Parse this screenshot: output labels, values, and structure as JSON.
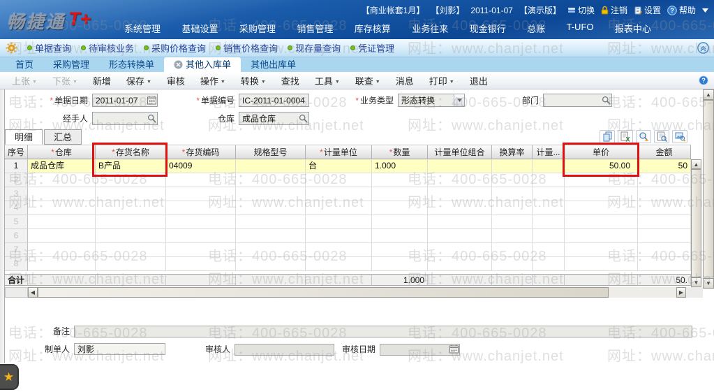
{
  "header": {
    "logo_text": "畅捷通",
    "logo_plus": "T+",
    "account_info": [
      "【商业帐套1月】",
      "【刘影】",
      "2011-01-07",
      "【演示版】"
    ],
    "actions": [
      {
        "icon": "switch-icon",
        "label": "切换"
      },
      {
        "icon": "logout-lock-icon",
        "label": "注销"
      },
      {
        "icon": "settings-icon",
        "label": "设置"
      },
      {
        "icon": "help-icon",
        "label": "帮助"
      },
      {
        "icon": "caret-down-icon",
        "label": ""
      }
    ],
    "menu": [
      "系统管理",
      "基础设置",
      "采购管理",
      "销售管理",
      "库存核算",
      "业务往来",
      "现金银行",
      "总账",
      "T-UFO",
      "报表中心"
    ]
  },
  "quicklinks": {
    "items": [
      "单据查询",
      "待审核业务",
      "采购价格查询",
      "销售价格查询",
      "现存量查询",
      "凭证管理"
    ]
  },
  "tabs": [
    {
      "label": "首页",
      "active": false,
      "closable": false
    },
    {
      "label": "采购管理",
      "active": false,
      "closable": false
    },
    {
      "label": "形态转换单",
      "active": false,
      "closable": false
    },
    {
      "label": "其他入库单",
      "active": true,
      "closable": true
    },
    {
      "label": "其他出库单",
      "active": false,
      "closable": false
    }
  ],
  "toolbar": {
    "items": [
      {
        "label": "上张",
        "dropdown": true,
        "disabled": true
      },
      {
        "label": "下张",
        "dropdown": true,
        "disabled": true
      },
      {
        "label": "新增",
        "dropdown": false,
        "disabled": false
      },
      {
        "label": "保存",
        "dropdown": true,
        "disabled": false
      },
      {
        "label": "审核",
        "dropdown": false,
        "disabled": false
      },
      {
        "label": "操作",
        "dropdown": true,
        "disabled": false
      },
      {
        "label": "转换",
        "dropdown": true,
        "disabled": false
      },
      {
        "label": "查找",
        "dropdown": false,
        "disabled": false
      },
      {
        "label": "工具",
        "dropdown": true,
        "disabled": false
      },
      {
        "label": "联查",
        "dropdown": true,
        "disabled": false
      },
      {
        "label": "消息",
        "dropdown": false,
        "disabled": false
      },
      {
        "label": "打印",
        "dropdown": true,
        "disabled": false
      },
      {
        "label": "退出",
        "dropdown": false,
        "disabled": false
      }
    ]
  },
  "form": {
    "doc_date": {
      "label": "单据日期",
      "required": true,
      "value": "2011-01-07"
    },
    "doc_no": {
      "label": "单据编号",
      "required": true,
      "value": "IC-2011-01-0004"
    },
    "biz_type": {
      "label": "业务类型",
      "required": true,
      "value": "形态转换"
    },
    "department": {
      "label": "部门",
      "required": false,
      "value": ""
    },
    "handler": {
      "label": "经手人",
      "required": false,
      "value": ""
    },
    "warehouse": {
      "label": "仓库",
      "required": false,
      "value": "成品仓库"
    }
  },
  "detail_tabs": [
    {
      "label": "明细",
      "active": true
    },
    {
      "label": "汇总",
      "active": false
    }
  ],
  "grid_toolbar_icons": [
    "copy-icon",
    "export-excel-icon",
    "batch-lookup-icon",
    "document-preview-icon",
    "picture-lookup-icon"
  ],
  "grid": {
    "columns": [
      {
        "label": "序号",
        "required": false
      },
      {
        "label": "仓库",
        "required": true
      },
      {
        "label": "存货名称",
        "required": true
      },
      {
        "label": "存货编码",
        "required": true
      },
      {
        "label": "规格型号",
        "required": false
      },
      {
        "label": "计量单位",
        "required": true
      },
      {
        "label": "数量",
        "required": true
      },
      {
        "label": "计量单位组合",
        "required": false
      },
      {
        "label": "换算率",
        "required": false
      },
      {
        "label": "计量...",
        "required": false
      },
      {
        "label": "单价",
        "required": false
      },
      {
        "label": "金额",
        "required": false
      }
    ],
    "rows": [
      [
        "1",
        "成品仓库",
        "B产品",
        "04009",
        "",
        "台",
        "1.000",
        "",
        "",
        "",
        "50.00",
        "50"
      ],
      [
        "2",
        "",
        "",
        "",
        "",
        "",
        "",
        "",
        "",
        "",
        "",
        ""
      ],
      [
        "3",
        "",
        "",
        "",
        "",
        "",
        "",
        "",
        "",
        "",
        "",
        ""
      ],
      [
        "4",
        "",
        "",
        "",
        "",
        "",
        "",
        "",
        "",
        "",
        "",
        ""
      ],
      [
        "5",
        "",
        "",
        "",
        "",
        "",
        "",
        "",
        "",
        "",
        "",
        ""
      ],
      [
        "6",
        "",
        "",
        "",
        "",
        "",
        "",
        "",
        "",
        "",
        "",
        ""
      ],
      [
        "7",
        "",
        "",
        "",
        "",
        "",
        "",
        "",
        "",
        "",
        "",
        ""
      ],
      [
        "8",
        "",
        "",
        "",
        "",
        "",
        "",
        "",
        "",
        "",
        "",
        ""
      ]
    ],
    "totals": [
      "合计",
      "",
      "",
      "",
      "",
      "",
      "1.000",
      "",
      "",
      "",
      "",
      "50."
    ]
  },
  "footer": {
    "remark": {
      "label": "备注",
      "value": ""
    },
    "creator": {
      "label": "制单人",
      "value": "刘影"
    },
    "auditor": {
      "label": "审核人",
      "value": ""
    },
    "audit_date": {
      "label": "审核日期",
      "value": ""
    }
  },
  "watermark": {
    "line1": "电话：400-665-0028",
    "line2": "网址：www.chanjet.net"
  },
  "colors": {
    "header_blue": "#0b4795",
    "tabstrip_blue": "#abd6f0",
    "link_navy": "#24409a",
    "selected_row_yellow": "#ffffc4",
    "highlight_red": "#e01010",
    "required_red": "#e05555"
  }
}
